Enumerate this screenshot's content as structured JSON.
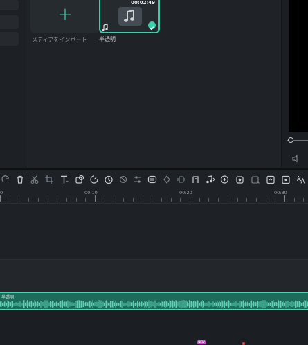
{
  "media_panel": {
    "import_label": "メディアをインポート",
    "clip": {
      "duration": "00:02:49",
      "label": "半透明",
      "thumb_icon": "music-note-icon",
      "badge_icon": "checkmark-icon"
    }
  },
  "timeline": {
    "ruler_labels": [
      "0",
      "00:10",
      "00:20",
      "00:30"
    ],
    "audio_clip_label": "半透明",
    "new_badge": "NEW"
  },
  "toolbar_icons": [
    "redo-icon",
    "delete-icon",
    "split-icon",
    "crop-icon",
    "text-icon",
    "mask-icon",
    "speed-icon",
    "duration-icon",
    "freeze-icon",
    "adjust-icon",
    "ai-cutout-icon",
    "keyframe-icon",
    "stabilize-icon",
    "beat-sync-icon",
    "audio-stretch-icon",
    "audio-ducking-icon",
    "record-icon",
    "smart-cutout-icon",
    "export-frame-icon",
    "snapshot-icon",
    "translate-icon"
  ],
  "colors": {
    "accent": "#3ccfaa",
    "clip_fill": "#1d6b5a",
    "background": "#1b1e22",
    "new_badge": "#d63fd1"
  }
}
